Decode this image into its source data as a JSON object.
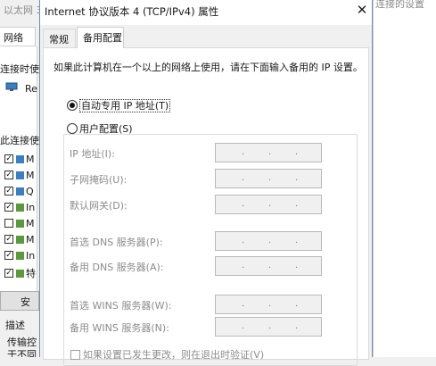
{
  "dialog": {
    "title": "Internet 协议版本 4 (TCP/IPv4) 属性",
    "close_glyph": "✕",
    "tabs": [
      {
        "label": "常规"
      },
      {
        "label": "备用配置"
      }
    ],
    "intro": "如果此计算机在一个以上的网络上使用，请在下面输入备用的 IP 设置。",
    "radio_auto": "自动专用 IP 地址(T)",
    "radio_user": "用户配置(S)",
    "fields": [
      {
        "label": "IP 地址(I):"
      },
      {
        "label": "子网掩码(U):"
      },
      {
        "label": "默认网关(D):"
      },
      {
        "label": "首选 DNS 服务器(P):"
      },
      {
        "label": "备用 DNS 服务器(A):"
      },
      {
        "label": "首选 WINS 服务器(W):"
      },
      {
        "label": "备用 WINS 服务器(N):"
      }
    ],
    "ip_dot": ".",
    "checkbox_label": "如果设置已发生更改，则在退出时验证(V)"
  },
  "background_left": {
    "window_title": "以太网 3",
    "tab_label": "网络",
    "connect_using": "连接时使用:",
    "adapter": "Re",
    "connection_uses": "此连接使用",
    "items": [
      {
        "checked": true,
        "label": "M"
      },
      {
        "checked": true,
        "label": "M"
      },
      {
        "checked": true,
        "label": "Q"
      },
      {
        "checked": true,
        "label": "In"
      },
      {
        "checked": false,
        "label": "M"
      },
      {
        "checked": true,
        "label": "M"
      },
      {
        "checked": true,
        "label": "In"
      },
      {
        "checked": true,
        "label": "特"
      }
    ],
    "install_button": "安",
    "description_label": "描述",
    "description_text": "传输控",
    "description_text2": "于不同"
  },
  "background_right": {
    "hint": "连接的设置"
  },
  "colors": {
    "window_border": "#6b8fb8",
    "disabled_text": "#8c8c8c"
  }
}
